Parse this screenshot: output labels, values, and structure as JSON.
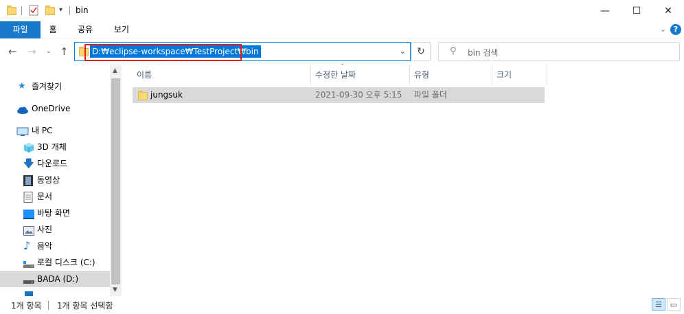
{
  "window": {
    "title": "bin"
  },
  "window_controls": {
    "minimize": "—",
    "maximize": "☐",
    "close": "✕"
  },
  "ribbon": {
    "tabs": [
      "파일",
      "홈",
      "공유",
      "보기"
    ],
    "help": "?"
  },
  "address": {
    "path": "D:₩eclipse-workspace₩TestProject₩bin",
    "search_placeholder": "bin 검색"
  },
  "nav": {
    "items": [
      {
        "label": "즐겨찾기",
        "icon": "star-icon"
      },
      {
        "label": "OneDrive",
        "icon": "cloud-icon"
      },
      {
        "label": "내 PC",
        "icon": "pc-icon"
      },
      {
        "label": "3D 개체",
        "icon": "3d-objects-icon"
      },
      {
        "label": "다운로드",
        "icon": "download-icon"
      },
      {
        "label": "동영상",
        "icon": "video-icon"
      },
      {
        "label": "문서",
        "icon": "document-icon"
      },
      {
        "label": "바탕 화면",
        "icon": "desktop-icon"
      },
      {
        "label": "사진",
        "icon": "pictures-icon"
      },
      {
        "label": "음악",
        "icon": "music-icon"
      },
      {
        "label": "로컬 디스크 (C:)",
        "icon": "local-disk-icon"
      },
      {
        "label": "BADA (D:)",
        "icon": "drive-icon"
      }
    ]
  },
  "columns": [
    "이름",
    "수정한 날짜",
    "유형",
    "크기"
  ],
  "files": [
    {
      "name": "jungsuk",
      "modified": "2021-09-30 오후 5:15",
      "type": "파일 폴더",
      "size": ""
    }
  ],
  "status": {
    "count": "1개 항목",
    "selected": "1개 항목 선택함"
  },
  "colors": {
    "accent": "#1979ca",
    "selection": "#0078d7",
    "highlight_box": "#e02020",
    "row_selected": "#d9d9d9"
  }
}
